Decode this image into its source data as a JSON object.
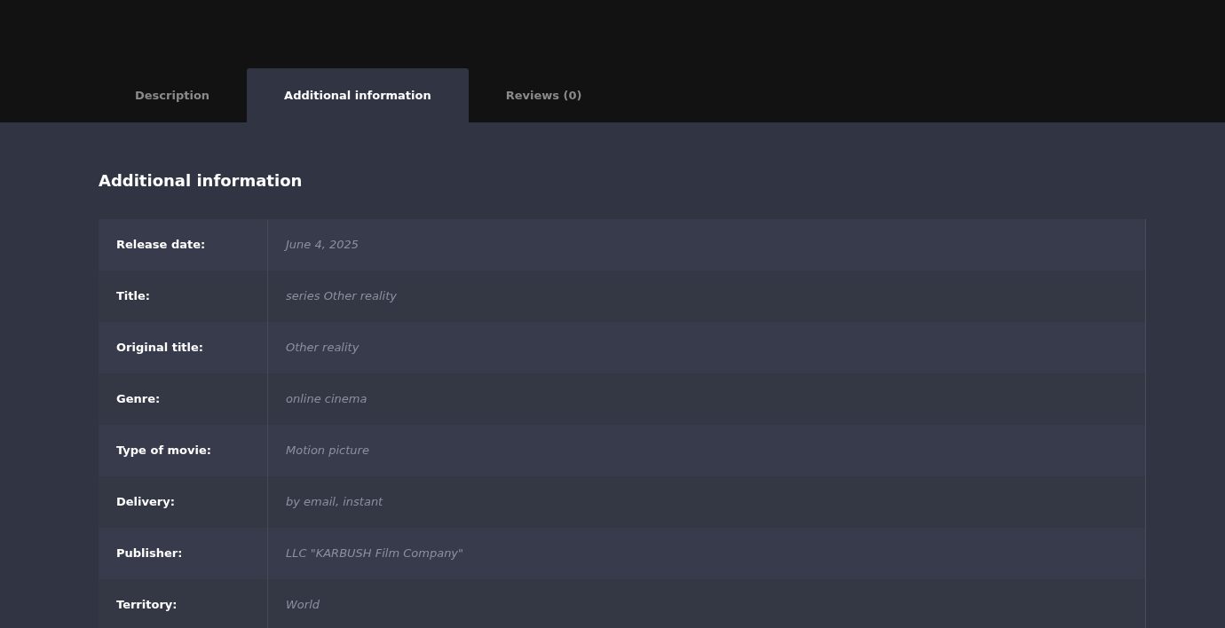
{
  "tabs": [
    {
      "label": "Description",
      "selected": false
    },
    {
      "label": "Additional information",
      "selected": true
    },
    {
      "label": "Reviews (0)",
      "selected": false
    }
  ],
  "heading": "Additional information",
  "rows": [
    {
      "label": "Release date:",
      "value": "June 4, 2025"
    },
    {
      "label": "Title:",
      "value": "series Other reality"
    },
    {
      "label": "Original title:",
      "value": "Other reality"
    },
    {
      "label": "Genre:",
      "value": "online cinema"
    },
    {
      "label": "Type of movie:",
      "value": "Motion picture"
    },
    {
      "label": "Delivery:",
      "value": "by email, instant"
    },
    {
      "label": "Publisher:",
      "value": "LLC \"KARBUSH Film Company\""
    },
    {
      "label": "Territory:",
      "value": "World"
    }
  ]
}
